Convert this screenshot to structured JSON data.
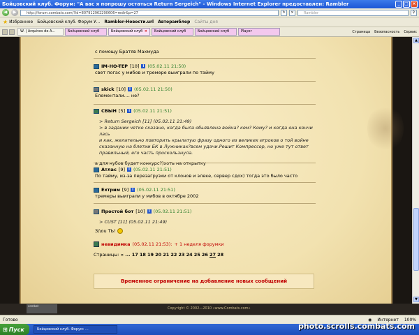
{
  "window": {
    "title": "Бойцовский клуб. Форум: \"А вас я попрошу остаться Return Sergeich\" - Windows Internet Explorer предоставлен: Rambler",
    "minimize": "_",
    "maximize": "□",
    "close": "×"
  },
  "address": {
    "url": "http://forum.combats.com/?id=807912962290606=redir&p=27",
    "search_placeholder": "Rambler"
  },
  "links": {
    "favorites": "Избранное",
    "items": [
      "Бойцовский клуб. Форум У...",
      "Rambler-Новости.url",
      "Автоpамблер",
      "Сайты дня"
    ]
  },
  "tabs": {
    "items": [
      "W. | Arquivos de A...",
      "Бойцовский клуб",
      "Бойцовский клуб",
      "Бойцовский клуб",
      "Бойцовский клуб",
      "Player"
    ],
    "commands": [
      "Страница",
      "Безопасность",
      "Сервис"
    ]
  },
  "posts": {
    "p0": {
      "body": "с помощу Братяв Махмуда"
    },
    "p1": {
      "author": "IM-HO-TEP",
      "level": "[10]",
      "date": "(05.02.11 21:50)",
      "body": "свет погас у мибов и тремере выиграли по тайму"
    },
    "p2": {
      "author": "skick",
      "level": "[10]",
      "date": "(05.02.11 21:50)",
      "body": "Елементали.... не?"
    },
    "p3": {
      "author": "СВЫН",
      "level": "[5]",
      "date": "(05.02.11 21:51)",
      "q1": ">  Return Sergeich [11] (05.02.11 21:49)",
      "q2": "> в задании четко сказано, когда была обьявлена война? кем? Кому? и когда она кончи лась",
      "q3": "и как, желательно повторить крылатую фразу одного из великих игроков о той войне",
      "q4": "сказанную на блетии БК в Лужниках?всем удачи.Решит Компрессор, но уже тут ответ",
      "q5": "правильный, его часть проскользнула.",
      "body": "а для нубов будет конкурс?)хоть на открытку"
    },
    "p4": {
      "author": "Атлас",
      "level": "[9]",
      "date": "(05.02.11 21:51)",
      "body": "По тайму, из-за перезагрузки от клонов и элеке, сервер сдох) тогда это было часто"
    },
    "p5": {
      "author": "Ехтрим",
      "level": "[9]",
      "date": "(05.02.11 21:51)",
      "body": "тремеры выиграли у мибов в октябре 2002"
    },
    "p6": {
      "author": "Простой бот",
      "level": "[10]",
      "date": "(05.02.11 21:51)",
      "q1": ">  CUST [11] (05.02.11 21:49)",
      "body": "З/\\ou ТЬ!"
    },
    "p7": {
      "author": "невидимка",
      "date": "(05.02.11 21:53):",
      "body": "+ 1 неделя форумки"
    }
  },
  "pagination": {
    "label": "Страницы:",
    "prev": "« ...",
    "pages": [
      "17",
      "18",
      "19",
      "20",
      "21",
      "22",
      "23",
      "24",
      "25",
      "26",
      "27",
      "28"
    ],
    "current": "27"
  },
  "limit_notice": "Временное ограничение на добавление новых сообщений",
  "footer": {
    "logo": "combat",
    "copyright": "Copyright © 2002—2010 «www.Combats.com»"
  },
  "status": {
    "left": "Готово",
    "internet": "Интернет",
    "zoom": "100%"
  },
  "taskbar": {
    "start": "Пуск",
    "task": "Бойцовский клуб. Форум: ...",
    "watermark": "photo.scrolls.combats.com"
  }
}
